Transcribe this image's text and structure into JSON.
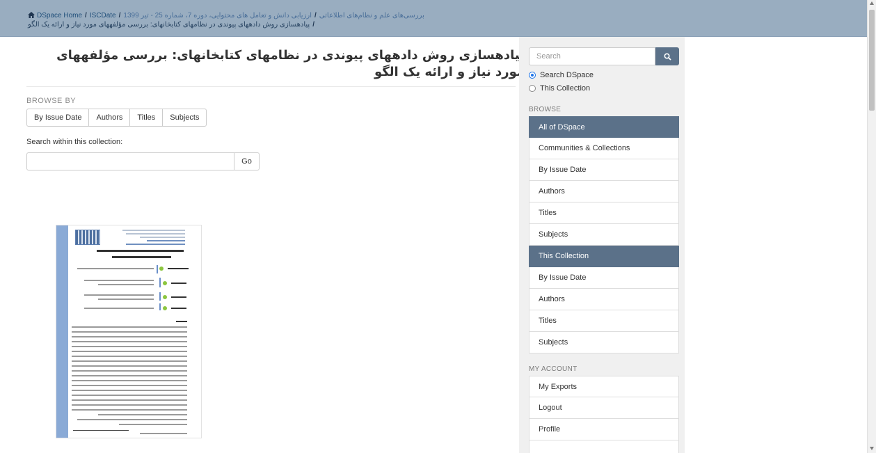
{
  "breadcrumb": {
    "home": "DSpace Home",
    "community": "ISCDate",
    "journal": "بررسی‌های علم و نظام‌های اطلاعاتی",
    "volume": "ارزیابی دانش و تعامل های محتوایی، دوره 7، شماره 25 - تیر 1399",
    "current": "پیادهسازی روش دادههای پیوندی در نظامهای کتابخانهای: بررسی مؤلفههای مورد نیاز و ارائه یک الگو"
  },
  "item": {
    "title": "پیادهسازی روش دادههای پیوندی در نظامهای کتابخانهای: بررسی مؤلفههای مورد نیاز و ارائه یک الگو"
  },
  "browse_by": {
    "heading": "BROWSE BY",
    "buttons": [
      "By Issue Date",
      "Authors",
      "Titles",
      "Subjects"
    ]
  },
  "collection_search": {
    "label": "Search within this collection:",
    "value": "",
    "go": "Go"
  },
  "sidebar": {
    "search_placeholder": "Search",
    "scope_options": [
      "Search DSpace",
      "This Collection"
    ],
    "selected_scope": "Search DSpace",
    "browse_heading": "BROWSE",
    "browse_items": [
      {
        "label": "All of DSpace",
        "active": true
      },
      {
        "label": "Communities & Collections",
        "active": false
      },
      {
        "label": "By Issue Date",
        "active": false
      },
      {
        "label": "Authors",
        "active": false
      },
      {
        "label": "Titles",
        "active": false
      },
      {
        "label": "Subjects",
        "active": false
      },
      {
        "label": "This Collection",
        "active": true
      },
      {
        "label": "By Issue Date",
        "active": false
      },
      {
        "label": "Authors",
        "active": false
      },
      {
        "label": "Titles",
        "active": false
      },
      {
        "label": "Subjects",
        "active": false
      }
    ],
    "account_heading": "MY ACCOUNT",
    "account_items": [
      "My Exports",
      "Logout",
      "Profile"
    ]
  },
  "icons": {
    "home": "home-icon",
    "search": "search-icon",
    "scroll_up": "chevron-up-icon",
    "scroll_down": "chevron-down-icon"
  },
  "colors": {
    "topbar": "#99adc0",
    "accent": "#5b7189",
    "sidebar_bg": "#f0f0f0"
  }
}
